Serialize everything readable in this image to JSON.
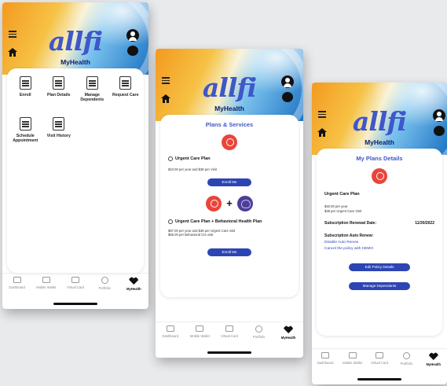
{
  "app": {
    "logo": "allfi",
    "subtitle": "MyHealth"
  },
  "screen1": {
    "tiles": [
      {
        "label": "Enroll",
        "icon": "edit-icon"
      },
      {
        "label": "Plan Details",
        "icon": "document-icon"
      },
      {
        "label": "Manage Dependents",
        "icon": "family-icon"
      },
      {
        "label": "Request Care",
        "icon": "doctor-icon"
      },
      {
        "label": "Schedule Appointment",
        "icon": "calendar-icon"
      },
      {
        "label": "Visit History",
        "icon": "clipboard-icon"
      }
    ]
  },
  "screen2": {
    "title": "Plans & Services",
    "plan1": {
      "name": "Urgent Care Plan",
      "price": "$10.00 per year and $38 per Visit",
      "button": "Enroll Me"
    },
    "plan2": {
      "name": "Urgent Care Plan + Behavioral Health Plan",
      "price1": "$87.00 per year and $38 per Urgent Care visit",
      "price2": "$66.00 per Behavioral Cre visit",
      "button": "Enroll Me"
    },
    "plus": "+"
  },
  "screen3": {
    "title": "My Plans Details",
    "plan_name": "Urgent Care Plan",
    "price1": "$40.00 per year",
    "price2": "$38 per Urgent Care Visit",
    "renewal_label": "Subscription Renewal Date:",
    "renewal_value": "11/30/2022",
    "auto_renew_label": "Subscription Auto Renew:",
    "disable_link": "Disable Auto Renew",
    "cancel_link": "Cancel the policy with HEMO",
    "edit_button": "Edit Policy Details",
    "manage_button": "Manage Dependants"
  },
  "nav": {
    "items": [
      {
        "label": "Dashboard"
      },
      {
        "label": "Mobile Wallet"
      },
      {
        "label": "Virtual Card"
      },
      {
        "label": "Portfolio"
      },
      {
        "label": "MyHealth"
      }
    ]
  },
  "colors": {
    "accent": "#2d45b3",
    "brand_blue": "#3f57c9",
    "red": "#e9453b",
    "purple": "#4b3f97"
  }
}
